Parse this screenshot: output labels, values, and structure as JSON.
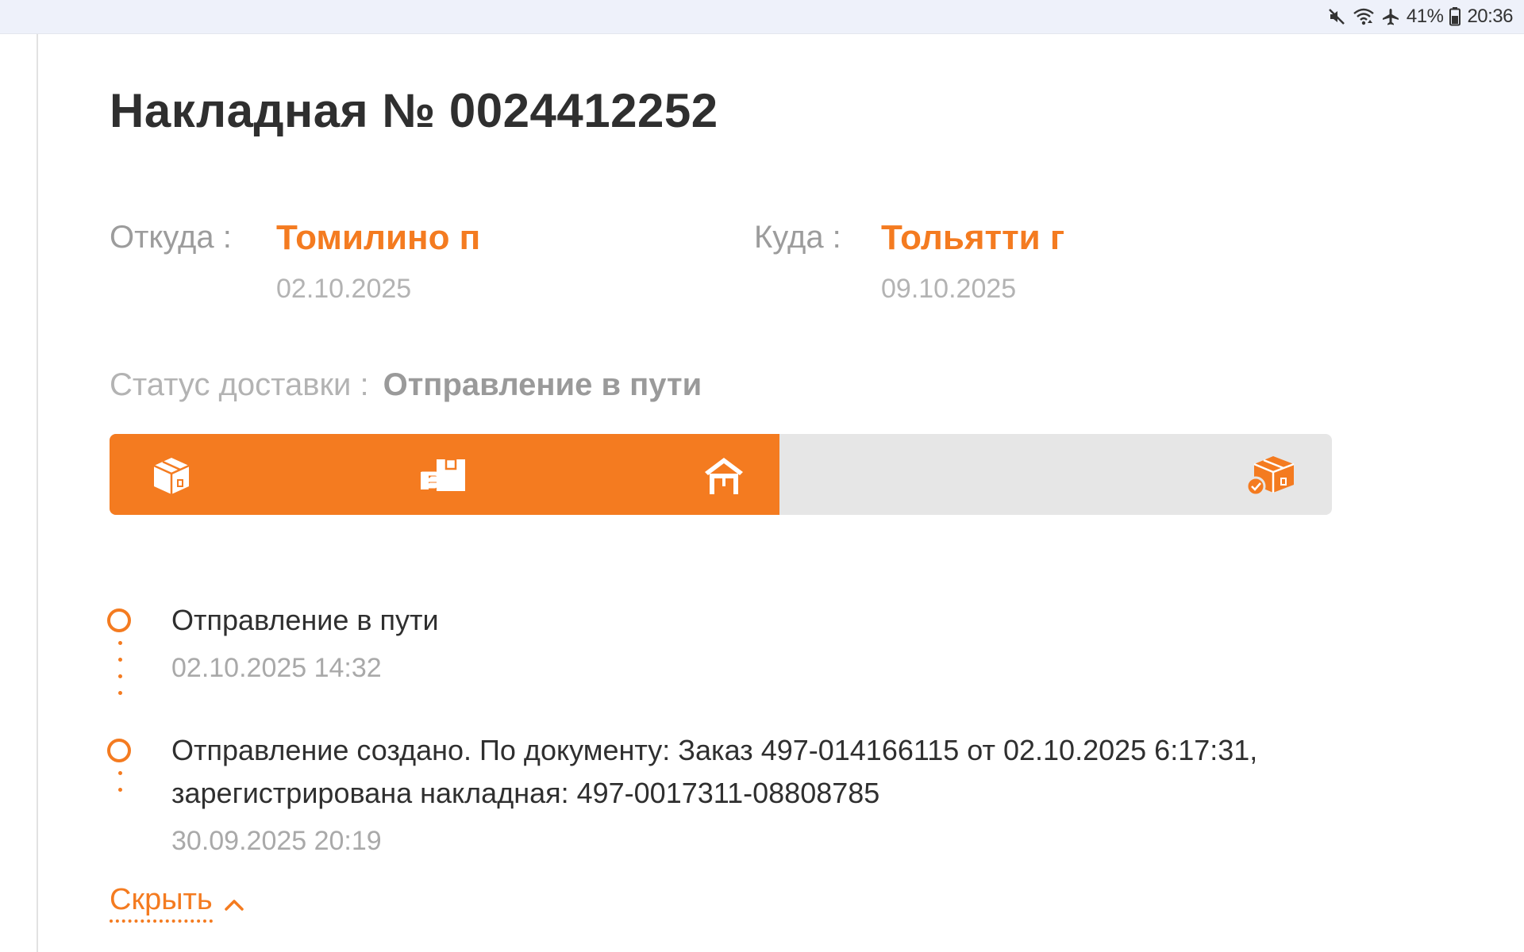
{
  "status_bar": {
    "battery_percent": "41%",
    "time": "20:36",
    "icons": [
      "mute-icon",
      "wifi-icon",
      "airplane-icon",
      "battery-icon"
    ]
  },
  "waybill": {
    "title": "Накладная № 0024412252",
    "from_label": "Откуда :",
    "from_city": "Томилино п",
    "from_date": "02.10.2025",
    "to_label": "Куда :",
    "to_city": "Тольятти г",
    "to_date": "09.10.2025",
    "status_label": "Статус доставки :",
    "status_value": "Отправление в пути"
  },
  "progress": {
    "completed_stages": 3,
    "total_stages": 4,
    "fill_fraction": 0.548,
    "stages": [
      {
        "icon": "package-icon",
        "done": true
      },
      {
        "icon": "package-handover-icon",
        "done": true
      },
      {
        "icon": "warehouse-icon",
        "done": true
      },
      {
        "icon": "delivered-package-icon",
        "done": false
      }
    ]
  },
  "timeline": [
    {
      "title": "Отправление в пути",
      "time": "02.10.2025 14:32"
    },
    {
      "title_line1": "Отправление создано. По документу: Заказ 497-014166115 от 02.10.2025 6:17:31,",
      "title_line2": "зарегистрирована накладная: 497-0017311-08808785",
      "time": "30.09.2025 20:19"
    }
  ],
  "hide_link": "Скрыть",
  "colors": {
    "accent": "#f47b20",
    "track": "#e6e6e6",
    "muted_text": "#b3b3b3",
    "heading": "#2f2f2f"
  }
}
